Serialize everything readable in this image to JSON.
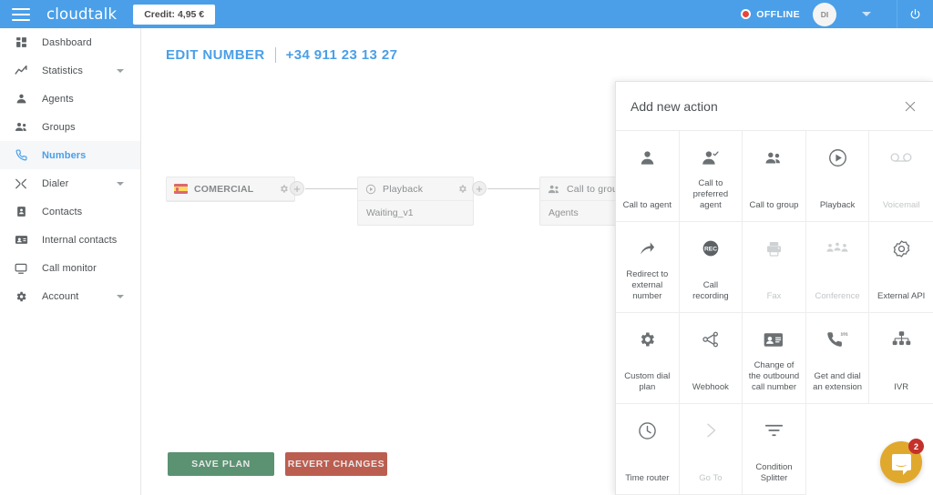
{
  "topbar": {
    "brand": "cloudtalk",
    "credit_label": "Credit: 4,95 €",
    "status_label": "OFFLINE",
    "status_color": "#e8453c",
    "avatar_initials": "DI",
    "bar_color": "#4a9fe8"
  },
  "sidebar": {
    "items": [
      {
        "label": "Dashboard",
        "icon": "dashboard-icon",
        "active": false,
        "expandable": false
      },
      {
        "label": "Statistics",
        "icon": "statistics-icon",
        "active": false,
        "expandable": true
      },
      {
        "label": "Agents",
        "icon": "agent-icon",
        "active": false,
        "expandable": false
      },
      {
        "label": "Groups",
        "icon": "groups-icon",
        "active": false,
        "expandable": false
      },
      {
        "label": "Numbers",
        "icon": "phone-icon",
        "active": true,
        "expandable": false
      },
      {
        "label": "Dialer",
        "icon": "dialer-icon",
        "active": false,
        "expandable": true
      },
      {
        "label": "Contacts",
        "icon": "contacts-icon",
        "active": false,
        "expandable": false
      },
      {
        "label": "Internal contacts",
        "icon": "internal-contacts-icon",
        "active": false,
        "expandable": false
      },
      {
        "label": "Call monitor",
        "icon": "call-monitor-icon",
        "active": false,
        "expandable": false
      },
      {
        "label": "Account",
        "icon": "gear-icon",
        "active": false,
        "expandable": true
      }
    ],
    "active_color": "#4a9fe8"
  },
  "main": {
    "page_title": "EDIT NUMBER",
    "page_number": "+34 911 23 13 27",
    "title_color": "#4a9fe8",
    "flow": {
      "nodes": [
        {
          "title": "COMERCIAL",
          "icon": "spain-flag-icon",
          "subtitle": ""
        },
        {
          "title": "Playback",
          "icon": "play-icon",
          "subtitle": "Waiting_v1"
        },
        {
          "title": "Call to group",
          "icon": "groups-icon",
          "subtitle": "Agents"
        }
      ]
    },
    "buttons": {
      "save": "SAVE PLAN",
      "revert": "REVERT CHANGES",
      "save_color": "#3f7f5a",
      "revert_color": "#b04232"
    }
  },
  "panel": {
    "title": "Add new action",
    "actions": [
      {
        "label": "Call to agent",
        "icon": "person-icon",
        "disabled": false
      },
      {
        "label": "Call to preferred agent",
        "icon": "person-check-icon",
        "disabled": false
      },
      {
        "label": "Call to group",
        "icon": "groups-icon",
        "disabled": false
      },
      {
        "label": "Playback",
        "icon": "play-circle-icon",
        "disabled": false
      },
      {
        "label": "Voicemail",
        "icon": "voicemail-icon",
        "disabled": true
      },
      {
        "label": "Redirect to external number",
        "icon": "redirect-arrow-icon",
        "disabled": false
      },
      {
        "label": "Call recording",
        "icon": "rec-icon",
        "disabled": false
      },
      {
        "label": "Fax",
        "icon": "printer-icon",
        "disabled": true
      },
      {
        "label": "Conference",
        "icon": "conference-icon",
        "disabled": true
      },
      {
        "label": "External API",
        "icon": "external-api-icon",
        "disabled": false
      },
      {
        "label": "Custom dial plan",
        "icon": "gear-icon",
        "disabled": false
      },
      {
        "label": "Webhook",
        "icon": "webhook-icon",
        "disabled": false
      },
      {
        "label": "Change of the outbound call number",
        "icon": "id-card-icon",
        "disabled": false
      },
      {
        "label": "Get and dial an extension",
        "icon": "phone-extension-icon",
        "disabled": false
      },
      {
        "label": "IVR",
        "icon": "ivr-tree-icon",
        "disabled": false
      },
      {
        "label": "Time router",
        "icon": "clock-icon",
        "disabled": false
      },
      {
        "label": "Go To",
        "icon": "chevron-right-icon",
        "disabled": true
      },
      {
        "label": "Condition Splitter",
        "icon": "filter-icon",
        "disabled": false
      }
    ]
  },
  "chat": {
    "badge_count": "2",
    "color": "#e0a92e",
    "badge_color": "#c4302b"
  }
}
